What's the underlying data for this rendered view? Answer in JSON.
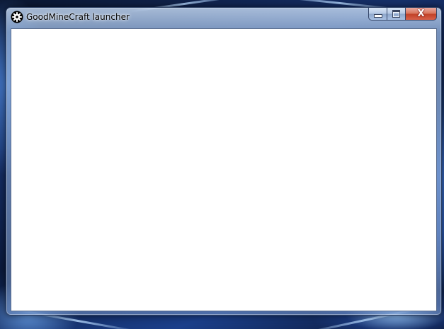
{
  "window": {
    "title": "GoodMineCraft launcher",
    "app_icon": "gear-icon",
    "controls": {
      "minimize_icon": "minimize-icon",
      "maximize_icon": "maximize-icon",
      "close_label": "X"
    }
  },
  "colors": {
    "close_button": "#c24228",
    "client_background": "#ffffff",
    "frame": "#2b3f63"
  }
}
